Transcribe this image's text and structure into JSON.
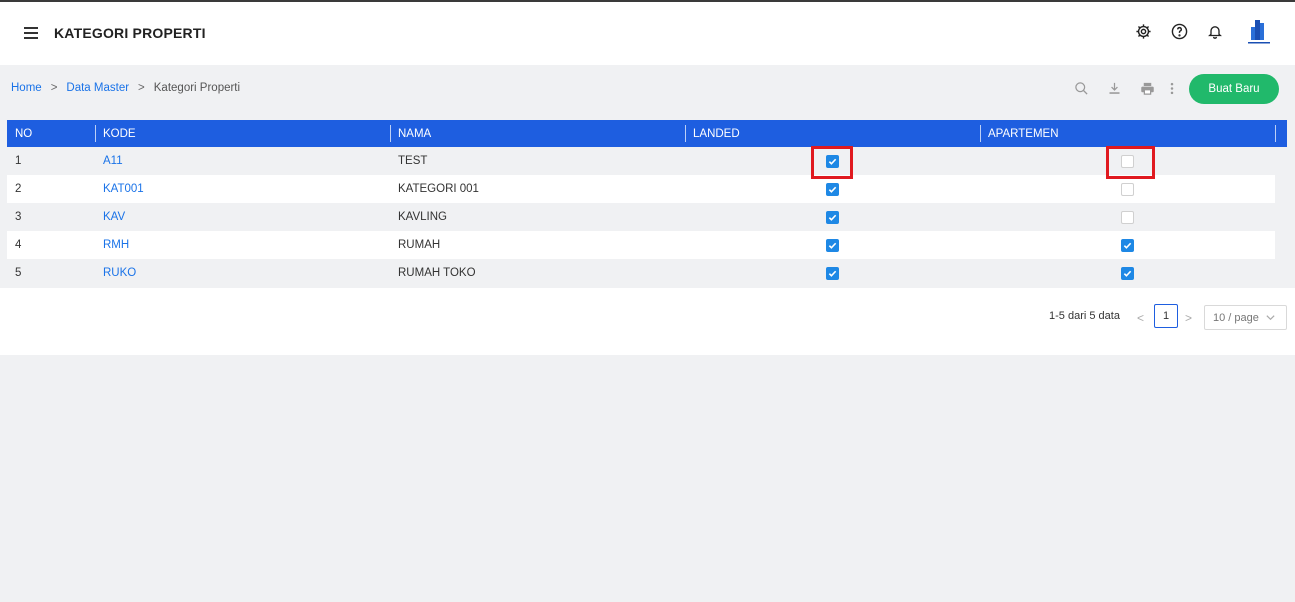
{
  "header": {
    "title": "KATEGORI PROPERTI",
    "icons": [
      "menu-icon",
      "gear-icon",
      "help-icon",
      "bell-icon",
      "company-logo"
    ]
  },
  "breadcrumb": {
    "items": [
      "Home",
      "Data Master",
      "Kategori Properti"
    ],
    "separator": ">"
  },
  "toolbar": {
    "icons": [
      "search-icon",
      "download-icon",
      "print-icon",
      "more-vertical-icon"
    ],
    "create_label": "Buat Baru"
  },
  "table": {
    "columns": [
      "NO",
      "KODE",
      "NAMA",
      "LANDED",
      "APARTEMEN"
    ],
    "rows": [
      {
        "no": "1",
        "kode": "A11",
        "nama": "TEST",
        "landed": true,
        "apartemen": false
      },
      {
        "no": "2",
        "kode": "KAT001",
        "nama": "KATEGORI 001",
        "landed": true,
        "apartemen": false
      },
      {
        "no": "3",
        "kode": "KAV",
        "nama": "KAVLING",
        "landed": true,
        "apartemen": false
      },
      {
        "no": "4",
        "kode": "RMH",
        "nama": "RUMAH",
        "landed": true,
        "apartemen": true
      },
      {
        "no": "5",
        "kode": "RUKO",
        "nama": "RUMAH TOKO",
        "landed": true,
        "apartemen": true
      }
    ]
  },
  "pagination": {
    "summary": "1-5 dari 5 data",
    "current_page": "1",
    "prev": "<",
    "next": ">",
    "page_size": "10 / page"
  },
  "colors": {
    "header_blue": "#1e5ee0",
    "primary_green": "#21b96b",
    "link_blue": "#1a73e8",
    "checkbox_blue": "#1e88e5",
    "highlight_red": "#e0191f"
  }
}
